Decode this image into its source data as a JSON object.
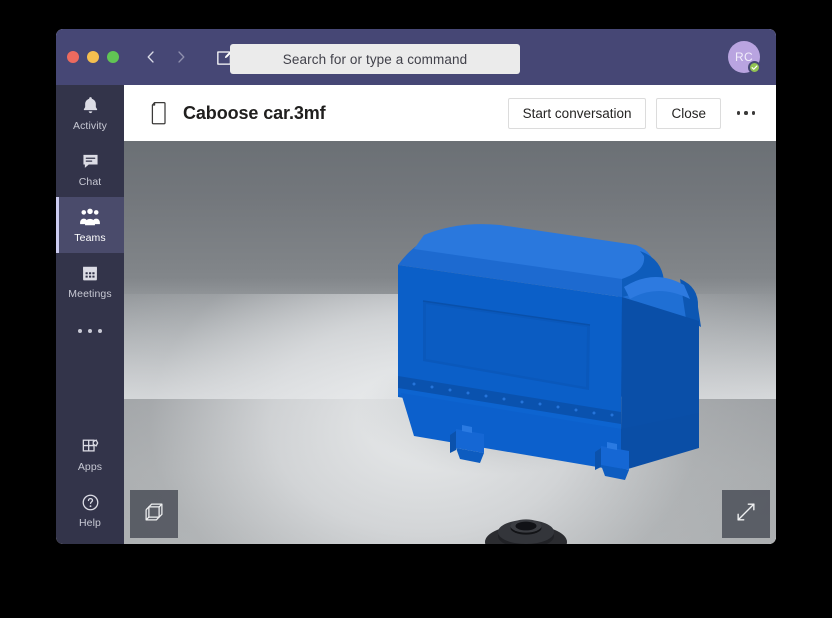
{
  "window": {
    "traffic_lights": [
      {
        "name": "close",
        "color": "#ec6a5f"
      },
      {
        "name": "minimize",
        "color": "#f5bf4f"
      },
      {
        "name": "zoom",
        "color": "#61c554"
      }
    ],
    "titlebar_color": "#464775"
  },
  "titlebar": {
    "back_icon": "chevron-left-icon",
    "forward_icon": "chevron-right-icon",
    "compose_icon": "compose-icon"
  },
  "search": {
    "placeholder": "Search for or type a command",
    "value": ""
  },
  "user": {
    "initials": "RC",
    "presence": "available",
    "presence_color": "#92c353",
    "avatar_color": "#b9a4e0"
  },
  "sidebar": {
    "background": "#33344a",
    "selected": "Teams",
    "items": [
      {
        "label": "Activity",
        "icon": "bell-icon"
      },
      {
        "label": "Chat",
        "icon": "chat-bubble-icon"
      },
      {
        "label": "Teams",
        "icon": "people-icon"
      },
      {
        "label": "Meetings",
        "icon": "calendar-icon"
      }
    ],
    "more_icon": "ellipsis-icon",
    "bottom_items": [
      {
        "label": "Apps",
        "icon": "apps-icon"
      },
      {
        "label": "Help",
        "icon": "help-circle-icon"
      }
    ]
  },
  "document": {
    "file_icon": "file-page-icon",
    "title": "Caboose car.3mf",
    "actions": [
      {
        "label": "Start conversation",
        "name": "start-conversation-button"
      },
      {
        "label": "Close",
        "name": "close-button"
      }
    ],
    "more_icon": "ellipsis-icon"
  },
  "viewer": {
    "background_top": "#6b7075",
    "background_bottom": "#abaeb0",
    "model_color": "#0b5fc8",
    "wheel_color": "#26272a",
    "controls": [
      {
        "name": "view-cube-button",
        "icon": "cube-icon"
      },
      {
        "name": "fullscreen-button",
        "icon": "expand-diagonal-icon"
      }
    ]
  }
}
